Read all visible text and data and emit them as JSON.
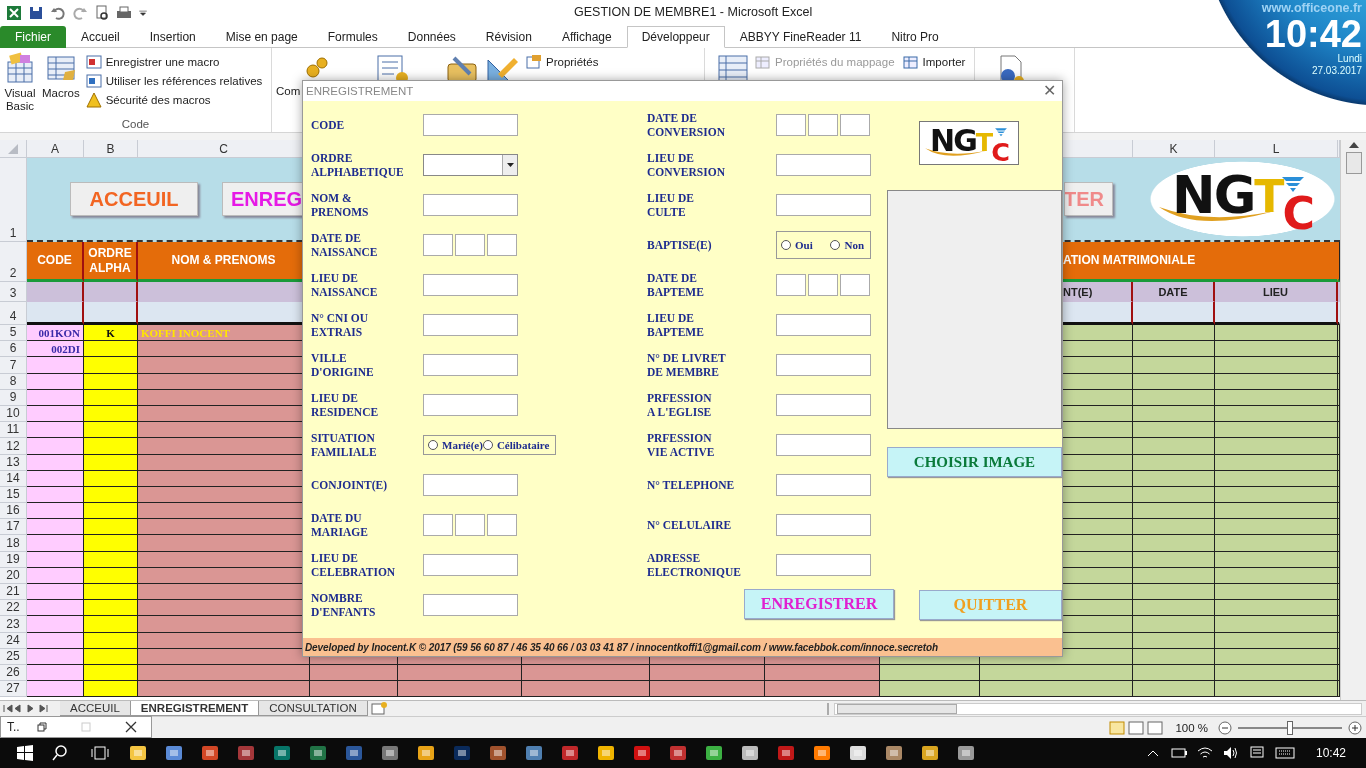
{
  "window": {
    "title": "GESTION DE MEMBRE1  -  Microsoft Excel"
  },
  "clock": {
    "site": "www.officeone.fr",
    "time": "10:42",
    "day": "Lundi",
    "date": "27.03.2017"
  },
  "ribbon_tabs": [
    {
      "label": "Fichier",
      "kind": "file",
      "selected": false
    },
    {
      "label": "Accueil",
      "kind": "tab",
      "selected": false
    },
    {
      "label": "Insertion",
      "kind": "tab",
      "selected": false
    },
    {
      "label": "Mise en page",
      "kind": "tab",
      "selected": false
    },
    {
      "label": "Formules",
      "kind": "tab",
      "selected": false
    },
    {
      "label": "Données",
      "kind": "tab",
      "selected": false
    },
    {
      "label": "Révision",
      "kind": "tab",
      "selected": false
    },
    {
      "label": "Affichage",
      "kind": "tab",
      "selected": false
    },
    {
      "label": "Développeur",
      "kind": "tab",
      "selected": true
    },
    {
      "label": "ABBYY FineReader 11",
      "kind": "tab",
      "selected": false
    },
    {
      "label": "Nitro Pro",
      "kind": "tab",
      "selected": false
    }
  ],
  "ribbon": {
    "code_group": {
      "large_buttons": [
        "Visual\nBasic",
        "Macros"
      ],
      "small_buttons": [
        "Enregistrer une macro",
        "Utiliser les références relatives",
        "Sécurité des macros"
      ],
      "label": "Code"
    },
    "controls_group": {
      "cut_label": "Com",
      "small_button": "Propriétés"
    },
    "xml_group": {
      "small_buttons": [
        {
          "label": "Propriétés du mappage",
          "disabled": true
        },
        {
          "label": "Importer",
          "disabled": false
        }
      ]
    }
  },
  "sheet": {
    "column_headers": [
      "A",
      "B",
      "C",
      "K",
      "L"
    ],
    "row_numbers": [
      "1",
      "2",
      "3",
      "4",
      "5",
      "6",
      "7",
      "8",
      "9",
      "10",
      "11",
      "12",
      "13",
      "14",
      "15",
      "16",
      "17",
      "18",
      "19",
      "20",
      "21",
      "22",
      "23",
      "24",
      "25",
      "26",
      "27"
    ],
    "nav_buttons": [
      {
        "label": "ACCEUIL",
        "color": "#f26522"
      },
      {
        "label": "ENREG",
        "color": "#e619e6"
      },
      {
        "label": "TER",
        "color": "#f08a8a"
      }
    ],
    "logo": "NGTC",
    "header": {
      "code": "CODE",
      "alpha": "ORDRE ALPHA",
      "name": "NOM & PRENOMS",
      "group": "ATION MATRIMONIALE"
    },
    "subheader": [
      "NT(E)",
      "DATE",
      "LIEU"
    ],
    "records": [
      {
        "code": "001KON",
        "alpha": "K",
        "name": "KOFFI INOCENT"
      },
      {
        "code": "002DI"
      }
    ]
  },
  "dialog": {
    "title": "ENREGISTREMENT",
    "close": "✕",
    "left_fields": [
      {
        "label": "CODE",
        "kind": "text"
      },
      {
        "label": "ORDRE\nALPHABETIQUE",
        "kind": "combo"
      },
      {
        "label": "NOM &\nPRENOMS",
        "kind": "text"
      },
      {
        "label": "DATE DE\nNAISSANCE",
        "kind": "date"
      },
      {
        "label": "LIEU DE\nNAISSANCE",
        "kind": "text"
      },
      {
        "label": "N° CNI OU\nEXTRAIS",
        "kind": "text"
      },
      {
        "label": "VILLE\nD'ORIGINE",
        "kind": "text"
      },
      {
        "label": "LIEU DE\nRESIDENCE",
        "kind": "text"
      },
      {
        "label": "SITUATION\nFAMILIALE",
        "kind": "radio",
        "options": [
          {
            "label": "Marié(e)",
            "selected": false
          },
          {
            "label": "Célibataire",
            "selected": false
          }
        ]
      },
      {
        "label": "CONJOINT(E)",
        "kind": "text"
      },
      {
        "label": "DATE DU\nMARIAGE",
        "kind": "date"
      },
      {
        "label": "LIEU DE\nCELEBRATION",
        "kind": "text"
      },
      {
        "label": "NOMBRE\nD'ENFANTS",
        "kind": "text"
      }
    ],
    "right_fields": [
      {
        "label": "DATE DE\nCONVERSION",
        "kind": "date"
      },
      {
        "label": "LIEU DE\nCONVERSION",
        "kind": "text"
      },
      {
        "label": "LIEU DE\nCULTE",
        "kind": "text"
      },
      {
        "label": "BAPTISE(E)",
        "kind": "radio",
        "options": [
          {
            "label": "Oui",
            "selected": false
          },
          {
            "label": "Non",
            "selected": false
          }
        ]
      },
      {
        "label": "DATE DE\nBAPTEME",
        "kind": "date"
      },
      {
        "label": "LIEU DE\nBAPTEME",
        "kind": "text"
      },
      {
        "label": "N° DE LIVRET\nDE MEMBRE",
        "kind": "text"
      },
      {
        "label": "PRFESSION\nA L'EGLISE",
        "kind": "text"
      },
      {
        "label": "PRFESSION\nVIE ACTIVE",
        "kind": "text"
      },
      {
        "label": "N° TELEPHONE",
        "kind": "text"
      },
      {
        "label": "N° CELULAIRE",
        "kind": "text"
      },
      {
        "label": "ADRESSE\nELECTRONIQUE",
        "kind": "text"
      }
    ],
    "logo": "NGTC",
    "choose_image": "CHOISIR IMAGE",
    "save": "ENREGISTRER",
    "quit": "QUITTER",
    "footer": "Developed by Inocent.K © 2017 (59 56 60 87 / 46 35 40 66 / 03 03 41 87 / innocentkoffi1@gmail.com / www.facebbok.com/innoce.secretoh"
  },
  "sheet_tabs": [
    {
      "label": "ACCEUIL",
      "selected": false
    },
    {
      "label": "ENREGISTREMENT",
      "selected": true
    },
    {
      "label": "CONSULTATION",
      "selected": false
    }
  ],
  "status_bar": {
    "zoom": "100 %",
    "zoom_slider": {
      "level": 0.5
    }
  },
  "thumbnail": {
    "title": "T.."
  },
  "taskbar": {
    "time": "10:42"
  }
}
